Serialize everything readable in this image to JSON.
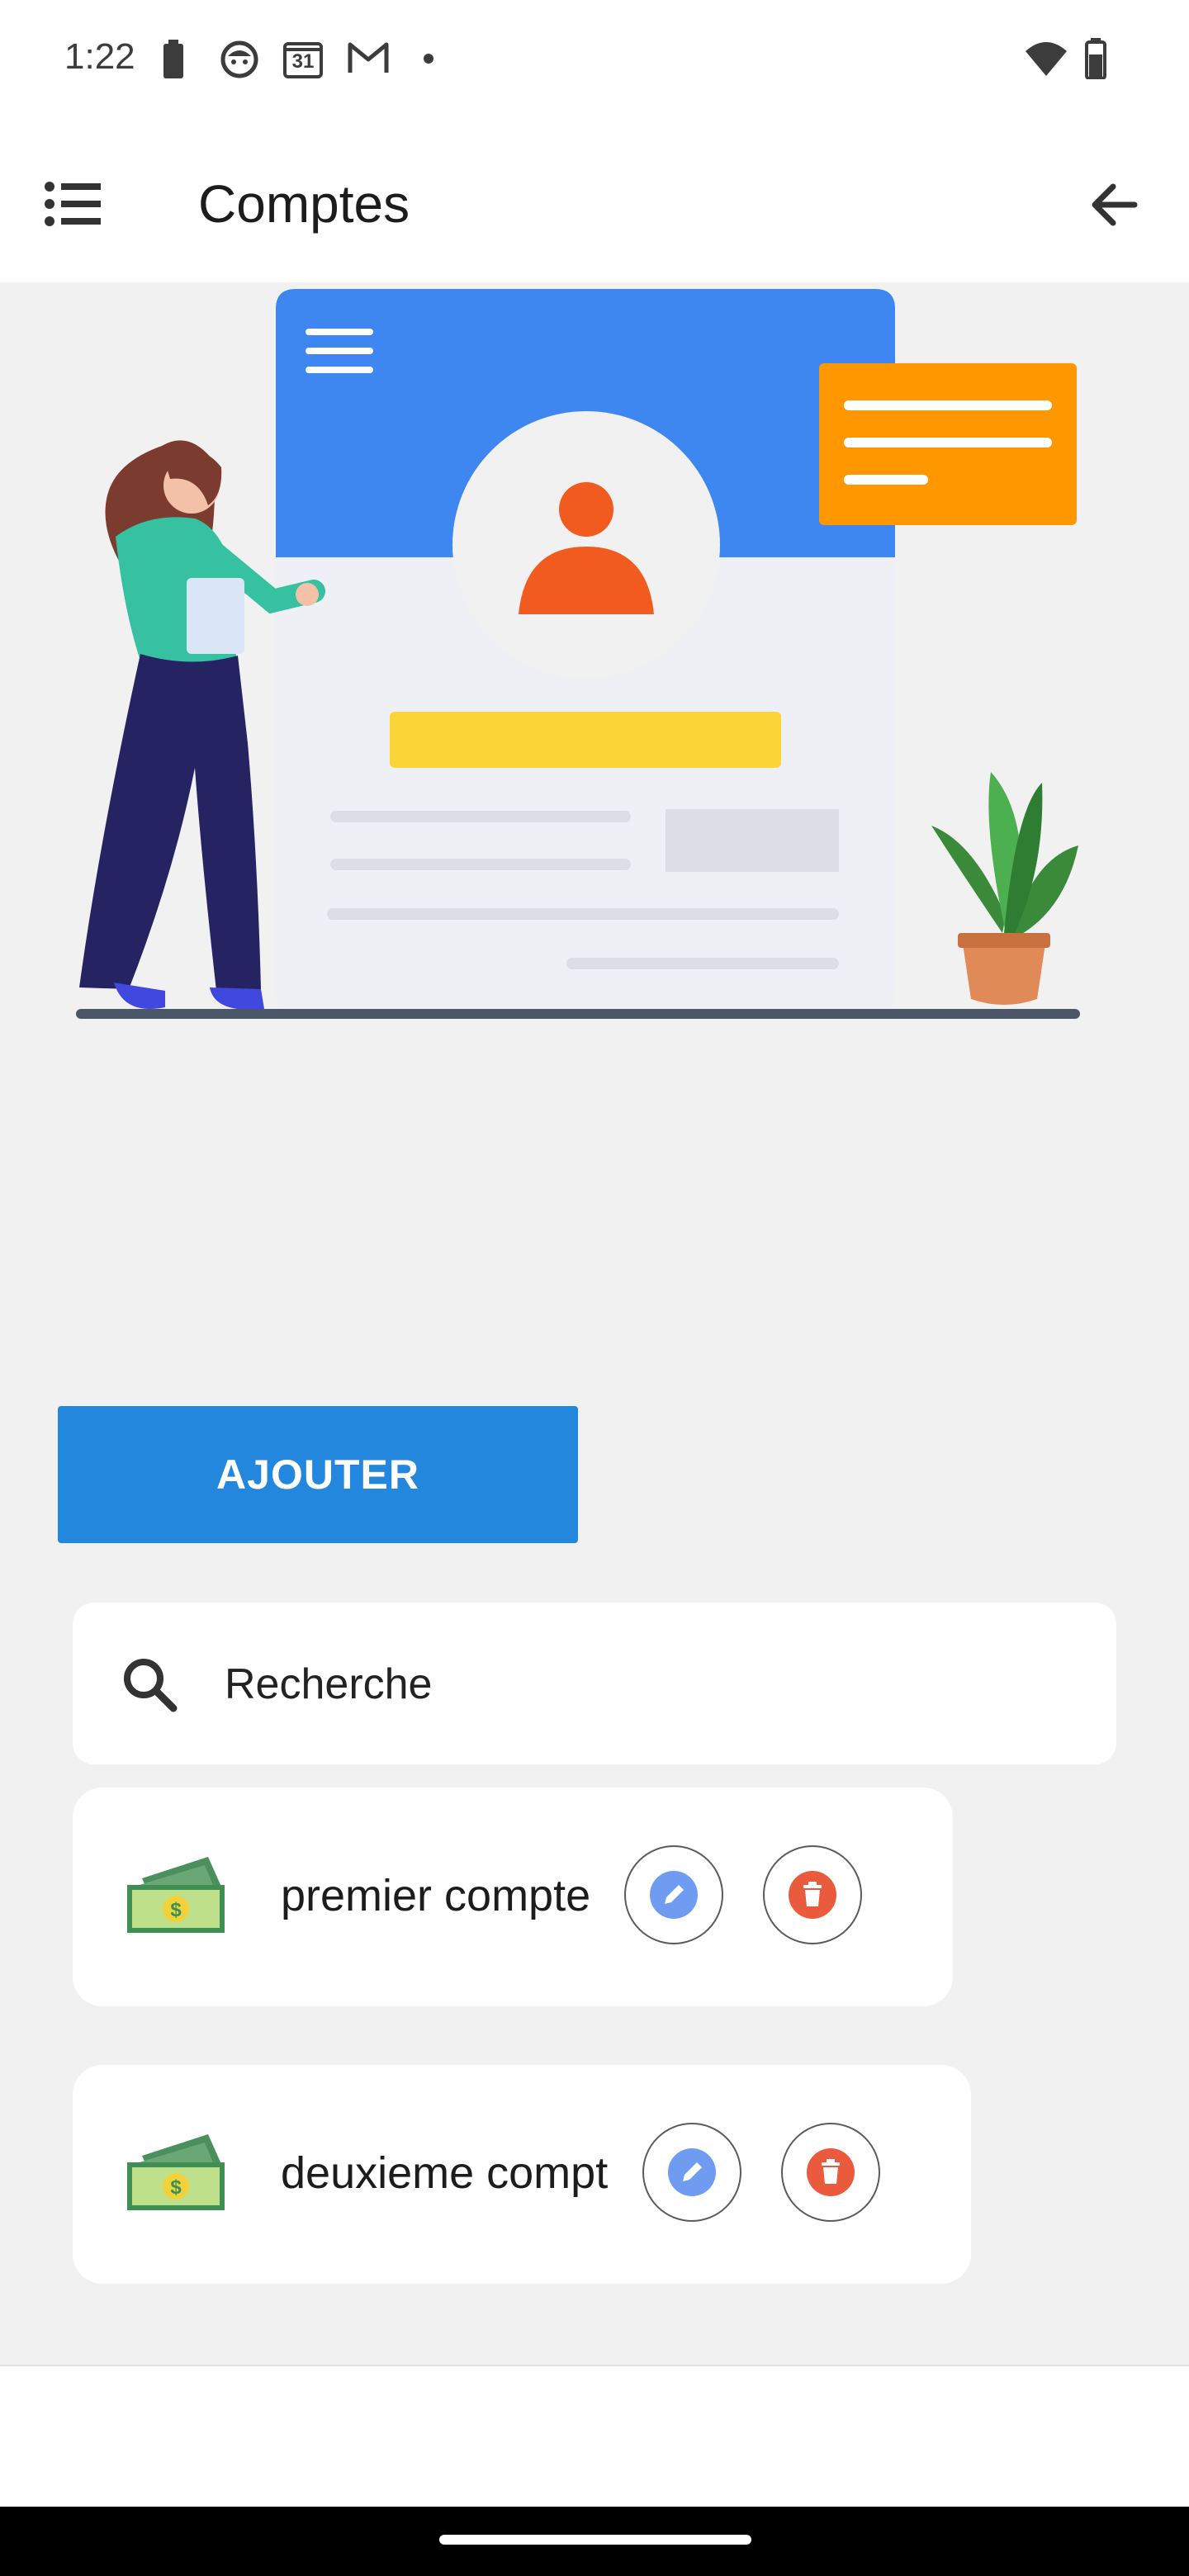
{
  "status_bar": {
    "time": "1:22",
    "left_icons": [
      "battery-saver-icon",
      "notification-face-icon",
      "calendar-icon",
      "gmail-icon",
      "dot-icon"
    ],
    "calendar_day": "31",
    "right_icons": [
      "wifi-icon",
      "battery-icon"
    ]
  },
  "app_bar": {
    "title": "Comptes",
    "menu_icon": "list-menu-icon",
    "back_icon": "arrow-back-icon"
  },
  "actions": {
    "add_label": "AJOUTER"
  },
  "search": {
    "placeholder": "Recherche",
    "icon": "search-icon"
  },
  "accounts": [
    {
      "name": "premier compte",
      "icon": "money-icon"
    },
    {
      "name": "deuxieme compt",
      "icon": "money-icon"
    }
  ],
  "colors": {
    "accent": "#2287dd",
    "edit_icon": "#6f9cf0",
    "delete_icon": "#ea5a3c",
    "background": "#f1f1f1"
  }
}
